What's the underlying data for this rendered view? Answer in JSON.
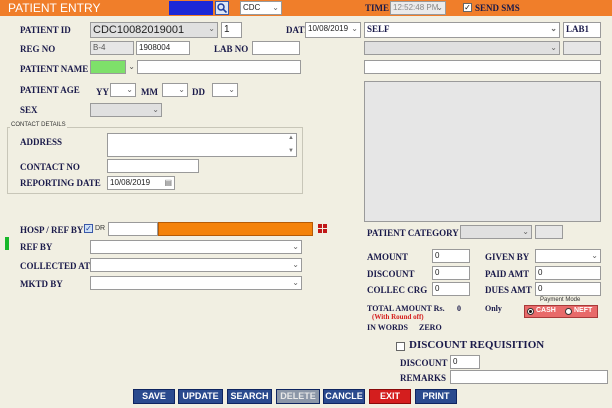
{
  "header": {
    "title": "PATIENT ENTRY",
    "cdc_select": "CDC",
    "time_label": "TIME",
    "time_value": "12:52:48 PM",
    "send_sms_label": "SEND SMS",
    "send_sms_checked": true
  },
  "patient": {
    "patient_id_label": "PATIENT ID",
    "patient_id_value": "CDC10082019001",
    "patient_seq": "1",
    "date_label": "DATE",
    "date_value": "10/08/2019",
    "reg_no_label": "REG NO",
    "reg_prefix": "B-4",
    "reg_value": "1908004",
    "lab_no_label": "LAB NO",
    "lab_no_value": "",
    "patient_name_label": "PATIENT NAME",
    "title_select": "",
    "patient_name_value": "",
    "patient_age_label": "PATIENT AGE",
    "yy_label": "YY",
    "mm_label": "MM",
    "dd_label": "DD",
    "sex_label": "SEX",
    "sex_value": ""
  },
  "contact": {
    "group_label": "CONTACT DETAILS",
    "address_label": "ADDRESS",
    "address_value": "",
    "contact_no_label": "CONTACT NO",
    "contact_no_value": "",
    "reporting_date_label": "REPORTING DATE",
    "reporting_date_value": "10/08/2019"
  },
  "referral": {
    "hosp_ref_by_label": "HOSP / REF BY",
    "dr_label": "DR",
    "dr_checked": true,
    "ref_by_label": "REF BY",
    "collected_at_label": "COLLECTED AT",
    "mktd_by_label": "MKTD BY"
  },
  "right": {
    "self_select": "SELF",
    "lab_select": "LAB1",
    "patient_category_label": "PATIENT CATEGORY"
  },
  "billing": {
    "amount_label": "AMOUNT",
    "amount_value": "0",
    "given_by_label": "GIVEN BY",
    "discount_label": "DISCOUNT",
    "discount_value": "0",
    "paid_amt_label": "PAID AMT",
    "paid_amt_value": "0",
    "collec_crg_label": "COLLEC CRG",
    "collec_crg_value": "0",
    "dues_amt_label": "DUES AMT",
    "dues_amt_value": "0",
    "total_amount_label": "TOTAL AMOUNT Rs.",
    "total_amount_value": "0",
    "only_label": "Only",
    "round_off_note": "(With Round off)",
    "in_words_label": "IN WORDS",
    "in_words_value": "ZERO",
    "payment_mode_label": "Payment Mode",
    "cash_label": "CASH",
    "neft_label": "NEFT",
    "payment_mode_selected": "CASH"
  },
  "discount_requisition": {
    "label": "DISCOUNT REQUISITION",
    "discount_label": "DISCOUNT",
    "discount_value": "0",
    "remarks_label": "REMARKS",
    "remarks_value": ""
  },
  "buttons": {
    "save": "SAVE",
    "update": "UPDATE",
    "search": "SEARCH",
    "delete": "DELETE",
    "cancel": "CANCLE",
    "exit": "EXIT",
    "print": "PRINT"
  },
  "colors": {
    "header_bg": "#f07e2a",
    "accent_blue": "#1c28d6",
    "button_blue": "#2a4a8e",
    "exit_red": "#d41e1e",
    "hosp_orange": "#f4820a",
    "name_green": "#7ee06a",
    "radio_bg": "#e06a6a"
  },
  "icons": {
    "search_icon": "magnifier",
    "calendar_icon": "calendar",
    "grid_icon": "grid"
  }
}
